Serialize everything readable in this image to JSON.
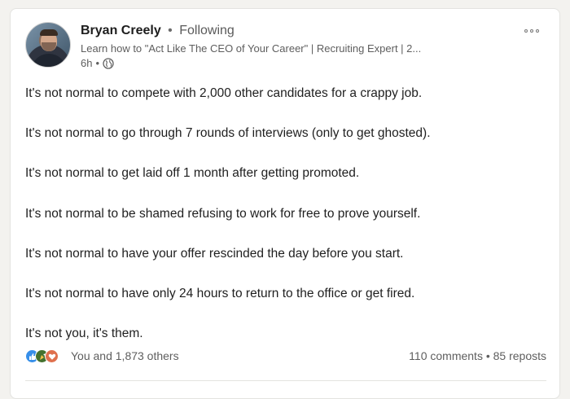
{
  "author": {
    "name": "Bryan Creely",
    "separator": "•",
    "follow_status": "Following",
    "headline": "Learn how to \"Act Like The CEO of Your Career\" | Recruiting Expert | 2...",
    "time": "6h",
    "time_separator": "•",
    "visibility_icon": "globe-icon"
  },
  "post": {
    "lines": [
      "It's not normal to compete with 2,000 other candidates for a crappy job.",
      "It's not normal to go through 7 rounds of interviews (only to get ghosted).",
      "It's not normal to get laid off 1 month after getting promoted.",
      "It's not normal to be shamed refusing to work for free to prove yourself.",
      "It's not normal to have your offer rescinded the day before you start.",
      "It's not normal to have only 24 hours to return to the office or get fired.",
      "It's not you, it's them."
    ]
  },
  "social": {
    "reactions_text": "You and 1,873 others",
    "comments": "110 comments",
    "counts_separator": "•",
    "reposts": "85 reposts",
    "reaction_icons": [
      "like-icon",
      "celebrate-icon",
      "love-icon"
    ]
  },
  "colors": {
    "like": "#378fe9",
    "celebrate": "#44712e",
    "love": "#df704d"
  }
}
